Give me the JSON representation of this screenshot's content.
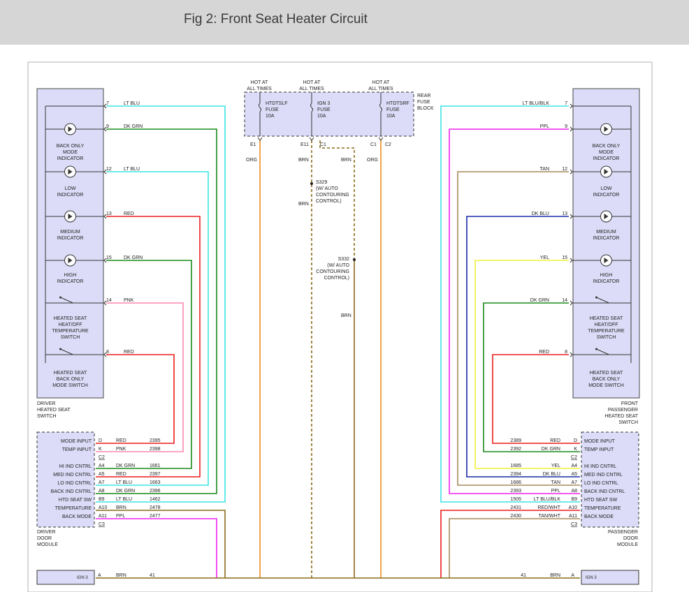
{
  "header": {
    "title": "Fig 2: Front Seat Heater Circuit"
  },
  "fuse_block": {
    "label": [
      "REAR",
      "FUSE",
      "BLOCK"
    ],
    "hot_label": [
      "HOT AT",
      "ALL TIMES"
    ],
    "fuses": [
      {
        "name": "HTDTSLF",
        "word": "FUSE",
        "amp": "10A",
        "pin": "E1",
        "color": "ORG"
      },
      {
        "name": "IGN 3",
        "word": "FUSE",
        "amp": "10A",
        "pin": "E11",
        "pin2": "C1",
        "color": "BRN",
        "color2": "BRN"
      },
      {
        "name": "HTDTSRF",
        "word": "FUSE",
        "amp": "10A",
        "pin": "C1",
        "pin2": "C2",
        "color": "ORG"
      }
    ]
  },
  "splices": [
    {
      "id": "S329",
      "lines": [
        "S329",
        "(W/ AUTO",
        "CONTOURING",
        "CONTROL)"
      ]
    },
    {
      "id": "S332",
      "lines": [
        "S332",
        "(W/ AUTO",
        "CONTOURING",
        "CONTROL)"
      ]
    }
  ],
  "brn_labels": [
    "BRN",
    "BRN",
    "BRN",
    "BRN"
  ],
  "driver_switch": {
    "name": [
      "DRIVER",
      "HEATED SEAT",
      "SWITCH"
    ],
    "components": [
      [
        "BACK ONLY",
        "MODE",
        "INDICATOR"
      ],
      [
        "LOW",
        "INDICATOR"
      ],
      [
        "MEDIUM",
        "INDICATOR"
      ],
      [
        "HIGH",
        "INDICATOR"
      ],
      [
        "HEATED SEAT",
        "HEAT/OFF",
        "TEMPERATURE",
        "SWITCH"
      ],
      [
        "HEATED SEAT",
        "BACK ONLY",
        "MODE SWITCH"
      ]
    ],
    "pins": [
      {
        "pin": "7",
        "color": "LT BLU"
      },
      {
        "pin": "9",
        "color": "DK GRN"
      },
      {
        "pin": "12",
        "color": "LT BLU"
      },
      {
        "pin": "13",
        "color": "RED"
      },
      {
        "pin": "15",
        "color": "DK GRN"
      },
      {
        "pin": "14",
        "color": "PNK"
      },
      {
        "pin": "8",
        "color": "RED"
      }
    ]
  },
  "passenger_switch": {
    "name": [
      "FRONT",
      "PASSENGER",
      "HEATED SEAT",
      "SWITCH"
    ],
    "components": [
      [
        "BACK ONLY",
        "MODE",
        "INDICATOR"
      ],
      [
        "LOW",
        "INDICATOR"
      ],
      [
        "MEDIUM",
        "INDICATOR"
      ],
      [
        "HIGH",
        "INDICATOR"
      ],
      [
        "HEATED SEAT",
        "HEAT/OFF",
        "TEMPERATURE",
        "SWITCH"
      ],
      [
        "HEATED SEAT",
        "BACK ONLY",
        "MODE SWITCH"
      ]
    ],
    "pins": [
      {
        "pin": "7",
        "color": "LT BLU/BLK"
      },
      {
        "pin": "9",
        "color": "PPL"
      },
      {
        "pin": "12",
        "color": "TAN"
      },
      {
        "pin": "13",
        "color": "DK BLU"
      },
      {
        "pin": "15",
        "color": "YEL"
      },
      {
        "pin": "14",
        "color": "DK GRN"
      },
      {
        "pin": "8",
        "color": "RED"
      }
    ]
  },
  "driver_module": {
    "name": [
      "DRIVER",
      "DOOR",
      "MODULE"
    ],
    "rows": [
      {
        "label": "MODE INPUT",
        "pin": "D",
        "color": "RED",
        "circuit": "2395"
      },
      {
        "label": "TEMP INPUT",
        "pin": "K",
        "color": "PNK",
        "circuit": "2398"
      },
      {
        "label": "",
        "pin": "C2",
        "color": "",
        "circuit": ""
      },
      {
        "label": "HI IND CNTRL",
        "pin": "A4",
        "color": "DK GRN",
        "circuit": "1661"
      },
      {
        "label": "MED IND CNTRL",
        "pin": "A5",
        "color": "RED",
        "circuit": "2397"
      },
      {
        "label": "LO IND CNTRL",
        "pin": "A7",
        "color": "LT BLU",
        "circuit": "1663"
      },
      {
        "label": "BACK IND CNTRL",
        "pin": "A8",
        "color": "DK GRN",
        "circuit": "2396"
      },
      {
        "label": "HTD SEAT SW",
        "pin": "B9",
        "color": "LT BLU",
        "circuit": "1462"
      },
      {
        "label": "TEMPERATURE",
        "pin": "A10",
        "color": "BRN",
        "circuit": "2478"
      },
      {
        "label": "BACK MODE",
        "pin": "A11",
        "color": "PPL",
        "circuit": "2477"
      },
      {
        "label": "",
        "pin": "C3",
        "color": "",
        "circuit": ""
      }
    ]
  },
  "passenger_module": {
    "name": [
      "PASSENGER",
      "DOOR",
      "MODULE"
    ],
    "rows": [
      {
        "label": "MODE INPUT",
        "pin": "D",
        "color": "RED",
        "circuit": "2389"
      },
      {
        "label": "TEMP INPUT",
        "pin": "K",
        "color": "DK GRN",
        "circuit": "2392"
      },
      {
        "label": "",
        "pin": "C2",
        "color": "",
        "circuit": ""
      },
      {
        "label": "HI IND CNTRL",
        "pin": "A4",
        "color": "YEL",
        "circuit": "1685"
      },
      {
        "label": "MED IND CNTRL",
        "pin": "A5",
        "color": "DK BLU",
        "circuit": "2394"
      },
      {
        "label": "LO IND CNTRL",
        "pin": "A7",
        "color": "TAN",
        "circuit": "1686"
      },
      {
        "label": "BACK IND CNTRL",
        "pin": "A8",
        "color": "PPL",
        "circuit": "2393"
      },
      {
        "label": "HTD SEAT SW",
        "pin": "B9",
        "color": "LT BLU/BLK",
        "circuit": "1505"
      },
      {
        "label": "TEMPERATURE",
        "pin": "A10",
        "color": "RED/WHT",
        "circuit": "2431"
      },
      {
        "label": "BACK MODE",
        "pin": "A11",
        "color": "TAN/WHT",
        "circuit": "2430"
      },
      {
        "label": "",
        "pin": "C3",
        "color": "",
        "circuit": ""
      }
    ]
  },
  "bottom": {
    "left": {
      "pin": "A",
      "color": "BRN",
      "circuit": "41",
      "partial": "IGN 3"
    },
    "right": {
      "pin": "A",
      "color": "BRN",
      "circuit": "41",
      "partial": "IGN 3"
    }
  },
  "wire_colors": {
    "lt_blu": "#3fe3e3",
    "dk_grn": "#1a8a1a",
    "red": "#ee1c1c",
    "pnk": "#ff88b0",
    "ppl": "#ee22ee",
    "tan": "#a68a5a",
    "dk_blu": "#1a2aa8",
    "yel": "#f2f23a",
    "org": "#f08a24",
    "brn": "#8a6a1a",
    "component_fill": "#dcdcf8"
  }
}
